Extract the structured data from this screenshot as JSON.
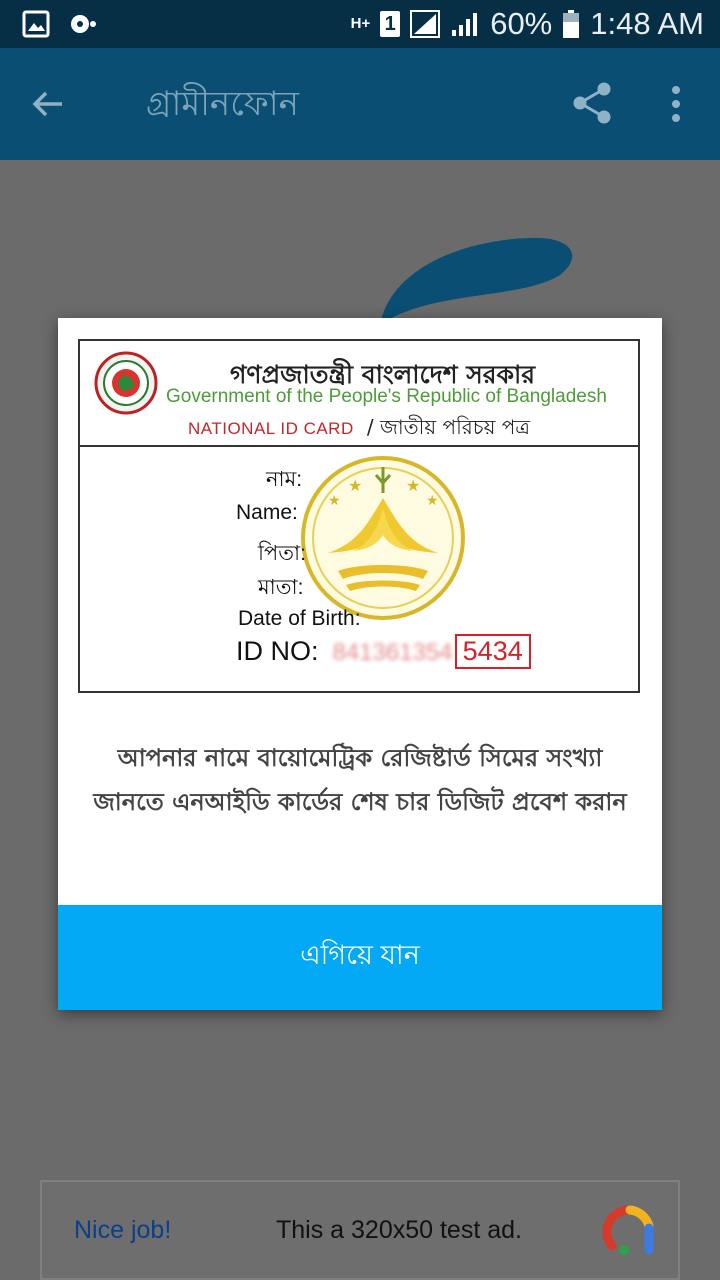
{
  "status_bar": {
    "battery": "60%",
    "time": "1:48 AM",
    "network_type": "H+",
    "sim_slot": "1"
  },
  "app_bar": {
    "title": "গ্রামীনফোন"
  },
  "dialog": {
    "card": {
      "gov_bn": "গণপ্রজাতন্ত্রী বাংলাদেশ সরকার",
      "gov_en": "Government of the People's Republic of Bangladesh",
      "nid_en": "NATIONAL ID CARD",
      "nid_bn": "/ জাতীয় পরিচয় পত্র",
      "fields": {
        "name_bn": "নাম:",
        "name_en": "Name:",
        "father_bn": "পিতা:",
        "mother_bn": "মাতা:",
        "dob": "Date of Birth:"
      },
      "id_label": "ID NO:",
      "id_blurred": "841361354",
      "id_last4": "5434"
    },
    "message": "আপনার নামে বায়োমেট্রিক রেজিষ্টার্ড সিমের সংখ্যা জানতে এনআইডি কার্ডের শেষ চার ডিজিট প্রবেশ করান",
    "proceed_label": "এগিয়ে যান"
  },
  "ad": {
    "nice": "Nice job!",
    "text": "This a 320x50 test ad."
  },
  "colors": {
    "status_bar": "#062f45",
    "app_bar": "#0a4f73",
    "proceed_button": "#03a9f4",
    "id_highlight": "#d2232a"
  }
}
